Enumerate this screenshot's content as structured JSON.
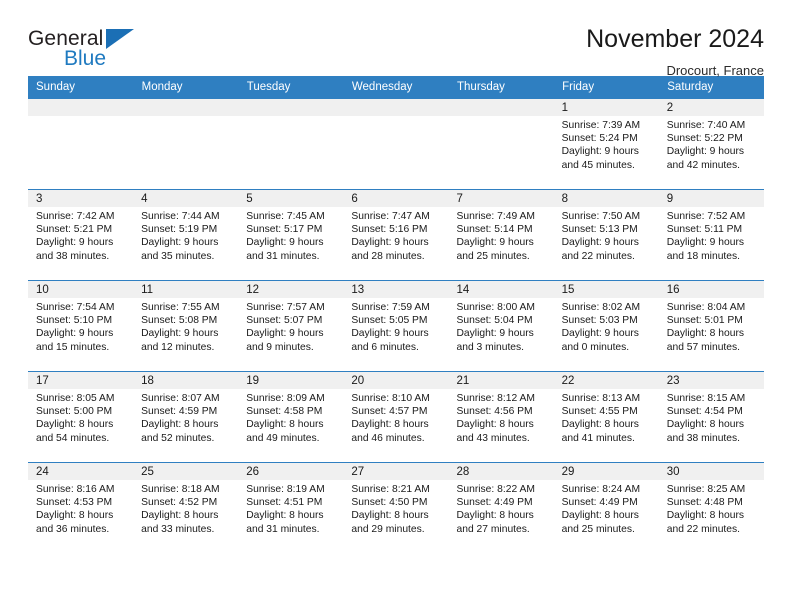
{
  "brand": {
    "word_one": "General",
    "word_two": "Blue",
    "triangle_icon": "triangle-icon",
    "accent_color": "#1f7ac0",
    "header_color": "#2f7fc1"
  },
  "header": {
    "title": "November 2024",
    "location": "Drocourt, France"
  },
  "calendar": {
    "weekday_headers": [
      "Sunday",
      "Monday",
      "Tuesday",
      "Wednesday",
      "Thursday",
      "Friday",
      "Saturday"
    ],
    "labels": {
      "sunrise_prefix": "Sunrise:",
      "sunset_prefix": "Sunset:",
      "daylight_prefix": "Daylight:"
    },
    "weeks": [
      [
        {
          "day": "",
          "blank": true
        },
        {
          "day": "",
          "blank": true
        },
        {
          "day": "",
          "blank": true
        },
        {
          "day": "",
          "blank": true
        },
        {
          "day": "",
          "blank": true
        },
        {
          "day": "1",
          "sunrise": "Sunrise: 7:39 AM",
          "sunset": "Sunset: 5:24 PM",
          "daylight_line1": "Daylight: 9 hours",
          "daylight_line2": "and 45 minutes."
        },
        {
          "day": "2",
          "sunrise": "Sunrise: 7:40 AM",
          "sunset": "Sunset: 5:22 PM",
          "daylight_line1": "Daylight: 9 hours",
          "daylight_line2": "and 42 minutes."
        }
      ],
      [
        {
          "day": "3",
          "sunrise": "Sunrise: 7:42 AM",
          "sunset": "Sunset: 5:21 PM",
          "daylight_line1": "Daylight: 9 hours",
          "daylight_line2": "and 38 minutes."
        },
        {
          "day": "4",
          "sunrise": "Sunrise: 7:44 AM",
          "sunset": "Sunset: 5:19 PM",
          "daylight_line1": "Daylight: 9 hours",
          "daylight_line2": "and 35 minutes."
        },
        {
          "day": "5",
          "sunrise": "Sunrise: 7:45 AM",
          "sunset": "Sunset: 5:17 PM",
          "daylight_line1": "Daylight: 9 hours",
          "daylight_line2": "and 31 minutes."
        },
        {
          "day": "6",
          "sunrise": "Sunrise: 7:47 AM",
          "sunset": "Sunset: 5:16 PM",
          "daylight_line1": "Daylight: 9 hours",
          "daylight_line2": "and 28 minutes."
        },
        {
          "day": "7",
          "sunrise": "Sunrise: 7:49 AM",
          "sunset": "Sunset: 5:14 PM",
          "daylight_line1": "Daylight: 9 hours",
          "daylight_line2": "and 25 minutes."
        },
        {
          "day": "8",
          "sunrise": "Sunrise: 7:50 AM",
          "sunset": "Sunset: 5:13 PM",
          "daylight_line1": "Daylight: 9 hours",
          "daylight_line2": "and 22 minutes."
        },
        {
          "day": "9",
          "sunrise": "Sunrise: 7:52 AM",
          "sunset": "Sunset: 5:11 PM",
          "daylight_line1": "Daylight: 9 hours",
          "daylight_line2": "and 18 minutes."
        }
      ],
      [
        {
          "day": "10",
          "sunrise": "Sunrise: 7:54 AM",
          "sunset": "Sunset: 5:10 PM",
          "daylight_line1": "Daylight: 9 hours",
          "daylight_line2": "and 15 minutes."
        },
        {
          "day": "11",
          "sunrise": "Sunrise: 7:55 AM",
          "sunset": "Sunset: 5:08 PM",
          "daylight_line1": "Daylight: 9 hours",
          "daylight_line2": "and 12 minutes."
        },
        {
          "day": "12",
          "sunrise": "Sunrise: 7:57 AM",
          "sunset": "Sunset: 5:07 PM",
          "daylight_line1": "Daylight: 9 hours",
          "daylight_line2": "and 9 minutes."
        },
        {
          "day": "13",
          "sunrise": "Sunrise: 7:59 AM",
          "sunset": "Sunset: 5:05 PM",
          "daylight_line1": "Daylight: 9 hours",
          "daylight_line2": "and 6 minutes."
        },
        {
          "day": "14",
          "sunrise": "Sunrise: 8:00 AM",
          "sunset": "Sunset: 5:04 PM",
          "daylight_line1": "Daylight: 9 hours",
          "daylight_line2": "and 3 minutes."
        },
        {
          "day": "15",
          "sunrise": "Sunrise: 8:02 AM",
          "sunset": "Sunset: 5:03 PM",
          "daylight_line1": "Daylight: 9 hours",
          "daylight_line2": "and 0 minutes."
        },
        {
          "day": "16",
          "sunrise": "Sunrise: 8:04 AM",
          "sunset": "Sunset: 5:01 PM",
          "daylight_line1": "Daylight: 8 hours",
          "daylight_line2": "and 57 minutes."
        }
      ],
      [
        {
          "day": "17",
          "sunrise": "Sunrise: 8:05 AM",
          "sunset": "Sunset: 5:00 PM",
          "daylight_line1": "Daylight: 8 hours",
          "daylight_line2": "and 54 minutes."
        },
        {
          "day": "18",
          "sunrise": "Sunrise: 8:07 AM",
          "sunset": "Sunset: 4:59 PM",
          "daylight_line1": "Daylight: 8 hours",
          "daylight_line2": "and 52 minutes."
        },
        {
          "day": "19",
          "sunrise": "Sunrise: 8:09 AM",
          "sunset": "Sunset: 4:58 PM",
          "daylight_line1": "Daylight: 8 hours",
          "daylight_line2": "and 49 minutes."
        },
        {
          "day": "20",
          "sunrise": "Sunrise: 8:10 AM",
          "sunset": "Sunset: 4:57 PM",
          "daylight_line1": "Daylight: 8 hours",
          "daylight_line2": "and 46 minutes."
        },
        {
          "day": "21",
          "sunrise": "Sunrise: 8:12 AM",
          "sunset": "Sunset: 4:56 PM",
          "daylight_line1": "Daylight: 8 hours",
          "daylight_line2": "and 43 minutes."
        },
        {
          "day": "22",
          "sunrise": "Sunrise: 8:13 AM",
          "sunset": "Sunset: 4:55 PM",
          "daylight_line1": "Daylight: 8 hours",
          "daylight_line2": "and 41 minutes."
        },
        {
          "day": "23",
          "sunrise": "Sunrise: 8:15 AM",
          "sunset": "Sunset: 4:54 PM",
          "daylight_line1": "Daylight: 8 hours",
          "daylight_line2": "and 38 minutes."
        }
      ],
      [
        {
          "day": "24",
          "sunrise": "Sunrise: 8:16 AM",
          "sunset": "Sunset: 4:53 PM",
          "daylight_line1": "Daylight: 8 hours",
          "daylight_line2": "and 36 minutes."
        },
        {
          "day": "25",
          "sunrise": "Sunrise: 8:18 AM",
          "sunset": "Sunset: 4:52 PM",
          "daylight_line1": "Daylight: 8 hours",
          "daylight_line2": "and 33 minutes."
        },
        {
          "day": "26",
          "sunrise": "Sunrise: 8:19 AM",
          "sunset": "Sunset: 4:51 PM",
          "daylight_line1": "Daylight: 8 hours",
          "daylight_line2": "and 31 minutes."
        },
        {
          "day": "27",
          "sunrise": "Sunrise: 8:21 AM",
          "sunset": "Sunset: 4:50 PM",
          "daylight_line1": "Daylight: 8 hours",
          "daylight_line2": "and 29 minutes."
        },
        {
          "day": "28",
          "sunrise": "Sunrise: 8:22 AM",
          "sunset": "Sunset: 4:49 PM",
          "daylight_line1": "Daylight: 8 hours",
          "daylight_line2": "and 27 minutes."
        },
        {
          "day": "29",
          "sunrise": "Sunrise: 8:24 AM",
          "sunset": "Sunset: 4:49 PM",
          "daylight_line1": "Daylight: 8 hours",
          "daylight_line2": "and 25 minutes."
        },
        {
          "day": "30",
          "sunrise": "Sunrise: 8:25 AM",
          "sunset": "Sunset: 4:48 PM",
          "daylight_line1": "Daylight: 8 hours",
          "daylight_line2": "and 22 minutes."
        }
      ]
    ]
  }
}
